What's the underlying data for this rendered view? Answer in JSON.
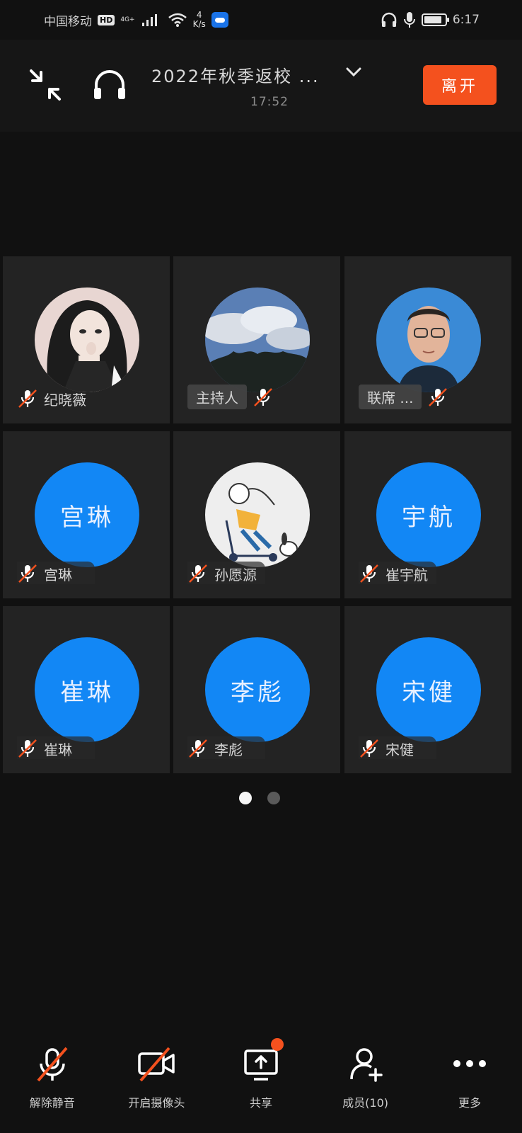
{
  "status_bar": {
    "carrier": "中国移动",
    "hd": "HD",
    "network": "4G+",
    "speed_value": "4",
    "speed_unit": "K/s",
    "time": "6:17"
  },
  "header": {
    "title": "2022年秋季返校 ...",
    "elapsed": "17:52",
    "leave_label": "离开"
  },
  "participants": [
    {
      "name": "纪晓薇",
      "avatar": "photo-anime-girl",
      "chip": ""
    },
    {
      "name": "",
      "avatar": "photo-sky-clouds",
      "chip": "主持人"
    },
    {
      "name": "",
      "avatar": "photo-man-glasses",
      "chip": "联席 ..."
    },
    {
      "name": "宫琳",
      "avatar_text": "宫琳",
      "avatar": "text-blue"
    },
    {
      "name": "孙愿源",
      "avatar": "photo-scooter-girl"
    },
    {
      "name": "崔宇航",
      "avatar_text": "宇航",
      "avatar": "text-blue"
    },
    {
      "name": "崔琳",
      "avatar_text": "崔琳",
      "avatar": "text-blue"
    },
    {
      "name": "李彪",
      "avatar_text": "李彪",
      "avatar": "text-blue"
    },
    {
      "name": "宋健",
      "avatar_text": "宋健",
      "avatar": "text-blue"
    }
  ],
  "pagination": {
    "pages": 2,
    "current": 1
  },
  "toolbar": {
    "unmute": "解除静音",
    "camera": "开启摄像头",
    "share": "共享",
    "members": "成员(10)",
    "more": "更多"
  },
  "colors": {
    "accent": "#f4511e",
    "avatar_blue": "#1287f5",
    "background": "#111111"
  }
}
